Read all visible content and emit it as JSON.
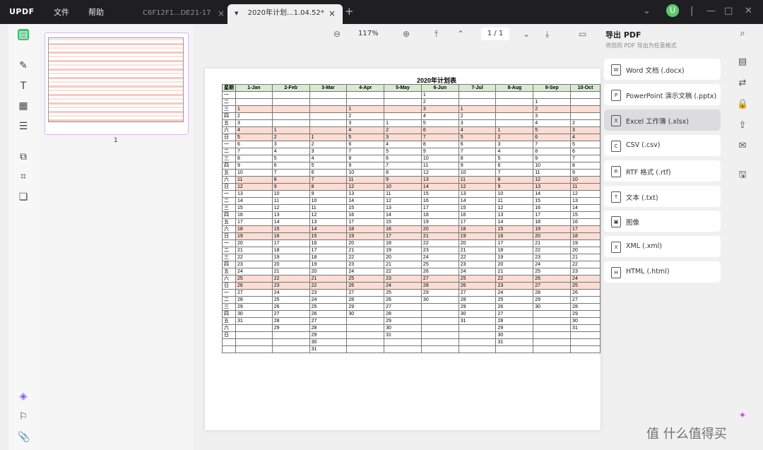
{
  "app": {
    "logo": "UPDF",
    "menu": [
      "文件",
      "帮助"
    ]
  },
  "tabs": [
    {
      "label": "C6F12F1...DE21-17",
      "active": false
    },
    {
      "label": "2020年计划...1.04.52*",
      "active": true
    }
  ],
  "user": {
    "initial": "U"
  },
  "thumbnail": {
    "page_number": "1"
  },
  "toolbar": {
    "zoom": "117%",
    "page": "1 / 1"
  },
  "document": {
    "title": "2020年计划表",
    "columns": [
      "星期",
      "1-Jan",
      "2-Feb",
      "3-Mar",
      "4-Apr",
      "5-May",
      "6-Jun",
      "7-Jul",
      "8-Aug",
      "9-Sep",
      "10-Oct"
    ],
    "rows": [
      [
        "一",
        "",
        "",
        "",
        "",
        "",
        "1",
        "",
        "",
        "",
        ""
      ],
      [
        "二",
        "",
        "",
        "",
        "",
        "",
        "2",
        "",
        "",
        "1",
        ""
      ],
      [
        "三",
        "1",
        "",
        "",
        "1",
        "",
        "3",
        "1",
        "",
        "2",
        ""
      ],
      [
        "四",
        "2",
        "",
        "",
        "2",
        "",
        "4",
        "2",
        "",
        "3",
        ""
      ],
      [
        "五",
        "3",
        "",
        "",
        "3",
        "1",
        "5",
        "3",
        "",
        "4",
        "2"
      ],
      [
        "六",
        "4",
        "1",
        "",
        "4",
        "2",
        "6",
        "4",
        "1",
        "5",
        "3"
      ],
      [
        "日",
        "5",
        "2",
        "1",
        "5",
        "3",
        "7",
        "5",
        "2",
        "6",
        "4"
      ],
      [
        "一",
        "6",
        "3",
        "2",
        "6",
        "4",
        "8",
        "6",
        "3",
        "7",
        "5"
      ],
      [
        "二",
        "7",
        "4",
        "3",
        "7",
        "5",
        "9",
        "7",
        "4",
        "8",
        "6"
      ],
      [
        "三",
        "8",
        "5",
        "4",
        "8",
        "6",
        "10",
        "8",
        "5",
        "9",
        "7"
      ],
      [
        "四",
        "9",
        "6",
        "5",
        "9",
        "7",
        "11",
        "9",
        "6",
        "10",
        "8"
      ],
      [
        "五",
        "10",
        "7",
        "6",
        "10",
        "8",
        "12",
        "10",
        "7",
        "11",
        "9"
      ],
      [
        "六",
        "11",
        "8",
        "7",
        "11",
        "9",
        "13",
        "11",
        "8",
        "12",
        "10"
      ],
      [
        "日",
        "12",
        "9",
        "8",
        "12",
        "10",
        "14",
        "12",
        "9",
        "13",
        "11"
      ],
      [
        "一",
        "13",
        "10",
        "9",
        "13",
        "11",
        "15",
        "13",
        "10",
        "14",
        "12"
      ],
      [
        "二",
        "14",
        "11",
        "10",
        "14",
        "12",
        "16",
        "14",
        "11",
        "15",
        "13"
      ],
      [
        "三",
        "15",
        "12",
        "11",
        "15",
        "13",
        "17",
        "15",
        "12",
        "16",
        "14"
      ],
      [
        "四",
        "16",
        "13",
        "12",
        "16",
        "14",
        "18",
        "16",
        "13",
        "17",
        "15"
      ],
      [
        "五",
        "17",
        "14",
        "13",
        "17",
        "15",
        "19",
        "17",
        "14",
        "18",
        "16"
      ],
      [
        "六",
        "18",
        "15",
        "14",
        "18",
        "16",
        "20",
        "18",
        "15",
        "19",
        "17"
      ],
      [
        "日",
        "19",
        "16",
        "15",
        "19",
        "17",
        "21",
        "19",
        "16",
        "20",
        "18"
      ],
      [
        "一",
        "20",
        "17",
        "16",
        "20",
        "18",
        "22",
        "20",
        "17",
        "21",
        "19"
      ],
      [
        "二",
        "21",
        "18",
        "17",
        "21",
        "19",
        "23",
        "21",
        "18",
        "22",
        "20"
      ],
      [
        "三",
        "22",
        "19",
        "18",
        "22",
        "20",
        "24",
        "22",
        "19",
        "23",
        "21"
      ],
      [
        "四",
        "23",
        "20",
        "19",
        "23",
        "21",
        "25",
        "23",
        "20",
        "24",
        "22"
      ],
      [
        "五",
        "24",
        "21",
        "20",
        "24",
        "22",
        "26",
        "24",
        "21",
        "25",
        "23"
      ],
      [
        "六",
        "25",
        "22",
        "21",
        "25",
        "23",
        "27",
        "25",
        "22",
        "26",
        "24"
      ],
      [
        "日",
        "26",
        "23",
        "22",
        "26",
        "24",
        "28",
        "26",
        "23",
        "27",
        "25"
      ],
      [
        "一",
        "27",
        "24",
        "23",
        "27",
        "25",
        "29",
        "27",
        "24",
        "28",
        "26"
      ],
      [
        "二",
        "28",
        "25",
        "24",
        "28",
        "26",
        "30",
        "28",
        "25",
        "29",
        "27"
      ],
      [
        "三",
        "29",
        "26",
        "25",
        "29",
        "27",
        "",
        "29",
        "26",
        "30",
        "28"
      ],
      [
        "四",
        "30",
        "27",
        "26",
        "30",
        "28",
        "",
        "30",
        "27",
        "",
        "29"
      ],
      [
        "五",
        "31",
        "28",
        "27",
        "",
        "29",
        "",
        "31",
        "28",
        "",
        "30"
      ],
      [
        "六",
        "",
        "29",
        "28",
        "",
        "30",
        "",
        "",
        "29",
        "",
        "31"
      ],
      [
        "日",
        "",
        "",
        "29",
        "",
        "31",
        "",
        "",
        "30",
        "",
        ""
      ],
      [
        "",
        "",
        "",
        "30",
        "",
        "",
        "",
        "",
        "31",
        "",
        ""
      ],
      [
        "",
        "",
        "",
        "31",
        "",
        "",
        "",
        "",
        "",
        "",
        ""
      ]
    ],
    "highlight_rows": [
      2,
      5,
      6,
      12,
      13,
      19,
      20,
      26,
      27
    ]
  },
  "export": {
    "title": "导出 PDF",
    "subtitle": "将您的 PDF 导出为任意格式",
    "items": [
      {
        "label": "Word 文档 (.docx)",
        "icon": "W"
      },
      {
        "label": "PowerPoint 演示文稿 (.pptx)",
        "icon": "P"
      },
      {
        "label": "Excel 工作簿 (.xlsx)",
        "icon": "X",
        "selected": true
      },
      {
        "label": "CSV (.csv)",
        "icon": "C"
      },
      {
        "label": "RTF 格式 (.rtf)",
        "icon": "R"
      },
      {
        "label": "文本 (.txt)",
        "icon": "T"
      },
      {
        "label": "图像",
        "icon": "▣"
      },
      {
        "label": "XML (.xml)",
        "icon": "X"
      },
      {
        "label": "HTML (.html)",
        "icon": "H"
      }
    ]
  },
  "watermark": "值 什么值得买"
}
